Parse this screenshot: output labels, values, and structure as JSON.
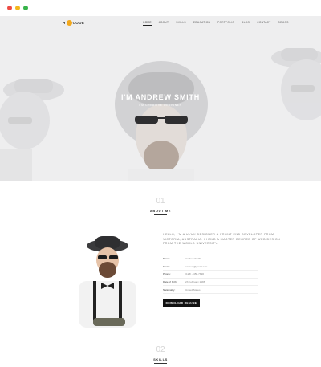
{
  "nav": {
    "logo_pre": "H",
    "logo_post": "CODE",
    "items": [
      "HOME",
      "ABOUT",
      "SKILLS",
      "EDUCATION",
      "PORTFOLIO",
      "BLOG",
      "CONTACT",
      "DEMOS"
    ]
  },
  "hero": {
    "title": "I'M ANDREW SMITH",
    "subtitle": "I'M CREATIVE DESIGNER"
  },
  "about": {
    "number": "01",
    "title": "ABOUT ME",
    "text": "HELLO, I'M A UI/UX DESIGNER & FRONT END DEVELOPER FROM VICTORIA, AUSTRALIA. I HOLD A MASTER DEGREE OF WEB DESIGN FROM THE WORLD UNIVERSITY.",
    "info": [
      {
        "label": "Name:",
        "value": "Andrew Smith"
      },
      {
        "label": "Email:",
        "value": "andrew@gmail.com"
      },
      {
        "label": "Phone:",
        "value": "(123) - 456-7890"
      },
      {
        "label": "Date of birth:",
        "value": "23 February 1988"
      },
      {
        "label": "Nationality:",
        "value": "United States"
      }
    ],
    "button": "DOWNLOAD RESUME"
  },
  "skills": {
    "number": "02",
    "title": "SKILLS"
  },
  "colors": {
    "accent": "#f2a81d",
    "close": "#ee4b45",
    "minimize": "#f3b61b",
    "maximize": "#37b34a"
  }
}
